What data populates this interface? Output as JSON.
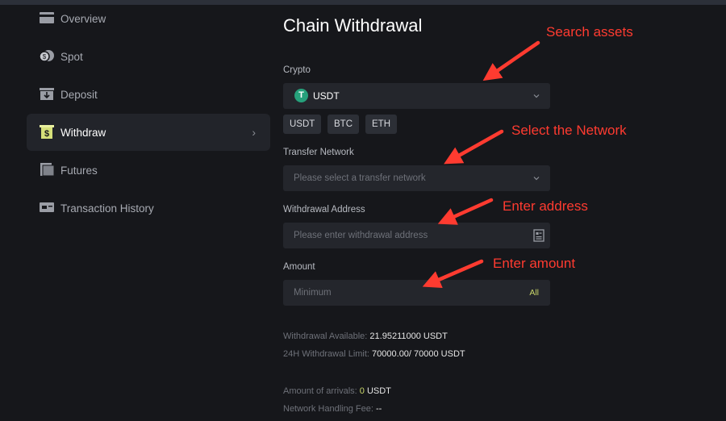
{
  "sidebar": {
    "items": [
      {
        "label": "Overview",
        "icon": "wallet-card-icon"
      },
      {
        "label": "Spot",
        "icon": "coins-icon"
      },
      {
        "label": "Deposit",
        "icon": "deposit-tray-icon"
      },
      {
        "label": "Withdraw",
        "icon": "dollar-withdraw-icon",
        "active": true
      },
      {
        "label": "Futures",
        "icon": "document-icon"
      },
      {
        "label": "Transaction History",
        "icon": "history-card-icon"
      }
    ]
  },
  "main": {
    "title": "Chain Withdrawal",
    "crypto": {
      "label": "Crypto",
      "selected": "USDT",
      "selected_icon": "tether-icon",
      "icon_glyph": "T",
      "quick_picks": [
        "USDT",
        "BTC",
        "ETH"
      ]
    },
    "network": {
      "label": "Transfer Network",
      "placeholder": "Please select a transfer network"
    },
    "address": {
      "label": "Withdrawal Address",
      "placeholder": "Please enter withdrawal address"
    },
    "amount": {
      "label": "Amount",
      "placeholder": "Minimum",
      "all_label": "All"
    },
    "info": {
      "available_label": "Withdrawal Available:",
      "available_value": "21.95211000 USDT",
      "limit_label": "24H Withdrawal Limit:",
      "limit_value": "70000.00/ 70000 USDT",
      "arrivals_label": "Amount of arrivals:",
      "arrivals_amount": "0",
      "arrivals_unit": "USDT",
      "fee_label": "Network Handling Fee:",
      "fee_value": "--"
    }
  },
  "annotations": {
    "search_assets": "Search assets",
    "select_network": "Select the Network",
    "enter_address": "Enter address",
    "enter_amount": "Enter amount"
  },
  "colors": {
    "background": "#16171b",
    "panel": "#24262c",
    "active_nav": "#22242a",
    "accent": "#c9d66a",
    "annotation": "#ff3b30",
    "tether": "#26a17b"
  }
}
